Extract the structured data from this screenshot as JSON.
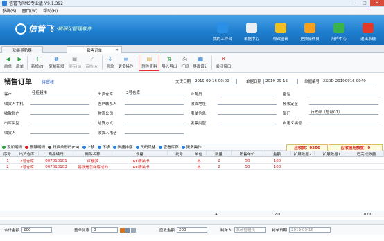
{
  "window": {
    "title": "信管飞RMS专业版 V9.1.392",
    "controls": [
      "—",
      "□",
      "✕"
    ]
  },
  "menu": [
    "系统(S)",
    "窗口(W)",
    "帮助(H)"
  ],
  "banner": {
    "brand": "信管飞",
    "slogan": "·精细化管理软件",
    "nav": [
      {
        "label": "我的工作台",
        "icon": "monitor-icon",
        "color": "#2a8fe6"
      },
      {
        "label": "单据中心",
        "icon": "document-icon",
        "color": "#e9eef5"
      },
      {
        "label": "修改密码",
        "icon": "key-icon",
        "color": "#f0c020"
      },
      {
        "label": "更换操作员",
        "icon": "user-switch-icon",
        "color": "#f5a020"
      },
      {
        "label": "用户中心",
        "icon": "globe-icon",
        "color": "#39b34a"
      },
      {
        "label": "退出系统",
        "icon": "power-icon",
        "color": "#e23a2a"
      }
    ]
  },
  "tabs": [
    {
      "label": "功能导航器"
    },
    {
      "label": "销售订单",
      "close": "✕"
    }
  ],
  "toolbar": [
    {
      "label": "前单",
      "icon": "arrow-left-icon",
      "glyph": "◀",
      "color": "#2a9a3a"
    },
    {
      "label": "后单",
      "icon": "arrow-right-icon",
      "glyph": "▶",
      "color": "#2a9a3a"
    },
    {
      "label": "新增(N)",
      "icon": "add-icon",
      "glyph": "＋",
      "color": "#2a9a3a"
    },
    {
      "label": "复制新增",
      "icon": "copy-add-icon",
      "glyph": "⧉",
      "color": "#2a7fd6"
    },
    {
      "label": "保存(S)",
      "icon": "save-icon",
      "glyph": "▣",
      "color": "#aaa",
      "disabled": true
    },
    {
      "label": "审核(A)",
      "icon": "audit-icon",
      "glyph": "✓",
      "color": "#aaa",
      "disabled": true
    },
    {
      "label": "引单",
      "icon": "import-order-icon",
      "glyph": "⇩",
      "color": "#2a7fd6"
    },
    {
      "label": "更多操作",
      "icon": "more-icon",
      "glyph": "≡",
      "color": "#2a7fd6",
      "dropdown": true
    },
    {
      "label": "附件资料",
      "icon": "attachment-icon",
      "glyph": "▤",
      "color": "#d9a640",
      "highlight": true
    },
    {
      "label": "导入导出",
      "icon": "import-export-icon",
      "glyph": "⇅",
      "color": "#2a9a3a",
      "dropdown": true
    },
    {
      "label": "打印",
      "icon": "print-icon",
      "glyph": "⎙",
      "color": "#555",
      "dropdown": true
    },
    {
      "label": "界面设计",
      "icon": "design-icon",
      "glyph": "▦",
      "color": "#2a7fd6"
    },
    {
      "label": "关闭窗口",
      "icon": "close-window-icon",
      "glyph": "✕",
      "color": "#d42020"
    }
  ],
  "header": {
    "title": "销售订单",
    "status": "待审核",
    "delivery_label": "交货日期",
    "delivery_value": "2019-09-16 00:00",
    "doc_date_label": "单据日期",
    "doc_date_value": "2019-09-16",
    "doc_no_label": "单据编号",
    "doc_no_value": "XSDD-20190916-0040"
  },
  "form": {
    "customer_label": "客户",
    "customer_value": "佳佳超市",
    "warehouse_label": "出货仓库",
    "warehouse_value": "2号仓库",
    "salesman_label": "业务员",
    "salesman_value": "",
    "remark_label": "备注",
    "remark_value": "",
    "cust_phone_label": "收货人手机",
    "cust_phone_value": "",
    "contact_label": "客户联系人",
    "contact_value": "",
    "address_label": "收货地址",
    "address_value": "",
    "deposit_label": "预收定金",
    "deposit_value": "",
    "account_label": "收款账户",
    "account_value": "",
    "logistics_label": "物流公司",
    "logistics_value": "",
    "quote_label": "引单信息",
    "quote_value": "",
    "dept_label": "部门",
    "dept_value": "行政部（总部01）",
    "outtype_label": "出库类型",
    "outtype_value": "",
    "settle_label": "结算方式",
    "settle_value": "",
    "invoice_label": "发票类型",
    "invoice_value": "",
    "custno_label": "自定义编号",
    "custno_value": "",
    "receiver_label": "收货人",
    "receiver_value": "",
    "recv_phone_label": "收货人电话",
    "recv_phone_value": ""
  },
  "gridtoolbar": {
    "items": [
      {
        "label": "添加明细",
        "color": "#2a9a3a"
      },
      {
        "label": "删除明细",
        "color": "#d42020"
      },
      {
        "label": "扫描条形码(F4)",
        "color": "#555"
      },
      {
        "label": "上移",
        "color": "#2a7fd6"
      },
      {
        "label": "下移",
        "color": "#2a7fd6"
      },
      {
        "label": "快捷排序",
        "color": "#2a7fd6"
      },
      {
        "label": "尺码风格",
        "color": "#2a7fd6"
      },
      {
        "label": "查看库存",
        "color": "#2a7fd6"
      },
      {
        "label": "更多操作",
        "color": "#2a7fd6"
      }
    ],
    "stock_text": "应收款：9256",
    "credit_text": "应收信用额度：0"
  },
  "grid": {
    "headers": [
      "序号",
      "出货仓库",
      "商品编码",
      "商品名称",
      "规格",
      "批号",
      "单位",
      "数量",
      "销售单价",
      "金额",
      "扩展数据2",
      "扩展数据1",
      "已完成数量"
    ],
    "rows": [
      [
        "1",
        "2号仓库",
        "007010101",
        "红楼梦",
        "16K精装书",
        "",
        "本",
        "2",
        "50",
        "100",
        "",
        "",
        ""
      ],
      [
        "2",
        "2号仓库",
        "007010103",
        "钢铁是怎样炼成的",
        "16K精装书",
        "",
        "本",
        "2",
        "50",
        "100",
        "",
        "",
        ""
      ]
    ],
    "sum_qty": "4",
    "sum_amount": "200",
    "sum_done": "0.00"
  },
  "footer": {
    "total_label": "合计金额",
    "total_value": "200",
    "discount_label": "整单优惠",
    "discount_value": "0",
    "receivable_label": "应收金额",
    "receivable_value": "200",
    "maker_label": "制单人",
    "maker_value": "系统管理员",
    "make_date_label": "制单日期",
    "make_date_value": "2019-09-16"
  }
}
